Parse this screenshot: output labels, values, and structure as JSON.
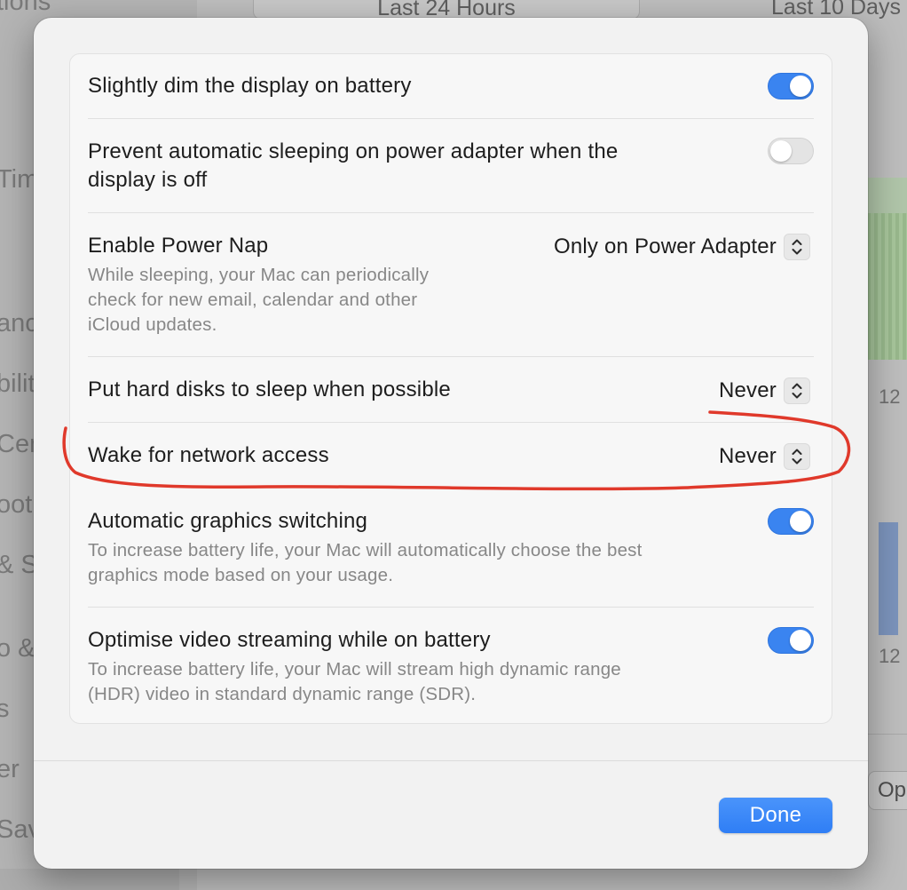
{
  "background": {
    "sidebar_fragments": [
      "tions",
      "Tim",
      "anc",
      "bilit",
      "Cen",
      "ootl",
      "& S",
      "o &",
      "s",
      "er",
      "Sav"
    ],
    "tabs": [
      "Last 24 Hours",
      "Last 10 Days"
    ],
    "axis_labels": [
      "12",
      "12"
    ],
    "options_fragment": "Op"
  },
  "settings": {
    "dim_display": {
      "title": "Slightly dim the display on battery",
      "enabled": true
    },
    "prevent_sleep": {
      "title_line1": "Prevent automatic sleeping on power adapter when the",
      "title_line2": "display is off",
      "enabled": false
    },
    "power_nap": {
      "title": "Enable Power Nap",
      "desc_line1": "While sleeping, your Mac can periodically",
      "desc_line2": "check for new email, calendar and other",
      "desc_line3": "iCloud updates.",
      "value": "Only on Power Adapter"
    },
    "hard_disks": {
      "title": "Put hard disks to sleep when possible",
      "value": "Never"
    },
    "wake_network": {
      "title": "Wake for network access",
      "value": "Never"
    },
    "graphics_switching": {
      "title": "Automatic graphics switching",
      "desc_line1": "To increase battery life, your Mac will automatically choose the best",
      "desc_line2": "graphics mode based on your usage.",
      "enabled": true
    },
    "video_streaming": {
      "title": "Optimise video streaming while on battery",
      "desc_line1": "To increase battery life, your Mac will stream high dynamic range",
      "desc_line2": "(HDR) video in standard dynamic range (SDR).",
      "enabled": true
    }
  },
  "footer": {
    "done_label": "Done"
  },
  "colors": {
    "accent": "#3a84f0",
    "annotation": "#e0392b"
  },
  "icons": {
    "toggle": "switch",
    "popup": "up-down-chevron-icon"
  }
}
